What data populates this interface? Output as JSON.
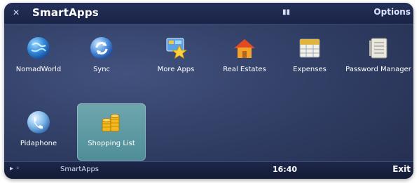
{
  "header": {
    "title": "SmartApps",
    "corner_icon": "close-icon",
    "indicator_icon": "signal-indicator-icon",
    "options_label": "Options"
  },
  "apps": [
    {
      "label": "NomadWorld",
      "icon": "globe-icon"
    },
    {
      "label": "Sync",
      "icon": "sync-icon"
    },
    {
      "label": "More Apps",
      "icon": "star-icon"
    },
    {
      "label": "Real Estates",
      "icon": "house-icon"
    },
    {
      "label": "Expenses",
      "icon": "calendar-icon"
    },
    {
      "label": "Password Manager",
      "icon": "notebook-icon"
    },
    {
      "label": "Pidaphone",
      "icon": "phone-icon"
    },
    {
      "label": "Shopping List",
      "icon": "coins-icon"
    }
  ],
  "selected_app": "Shopping List",
  "footer": {
    "left_icon": "menu-icon",
    "app_name": "SmartApps",
    "time": "16:40",
    "exit_label": "Exit"
  },
  "colors": {
    "background": "#2f3c62",
    "bars": "#1a2447",
    "selection": "#5f9aa3",
    "text": "#ffffff"
  }
}
